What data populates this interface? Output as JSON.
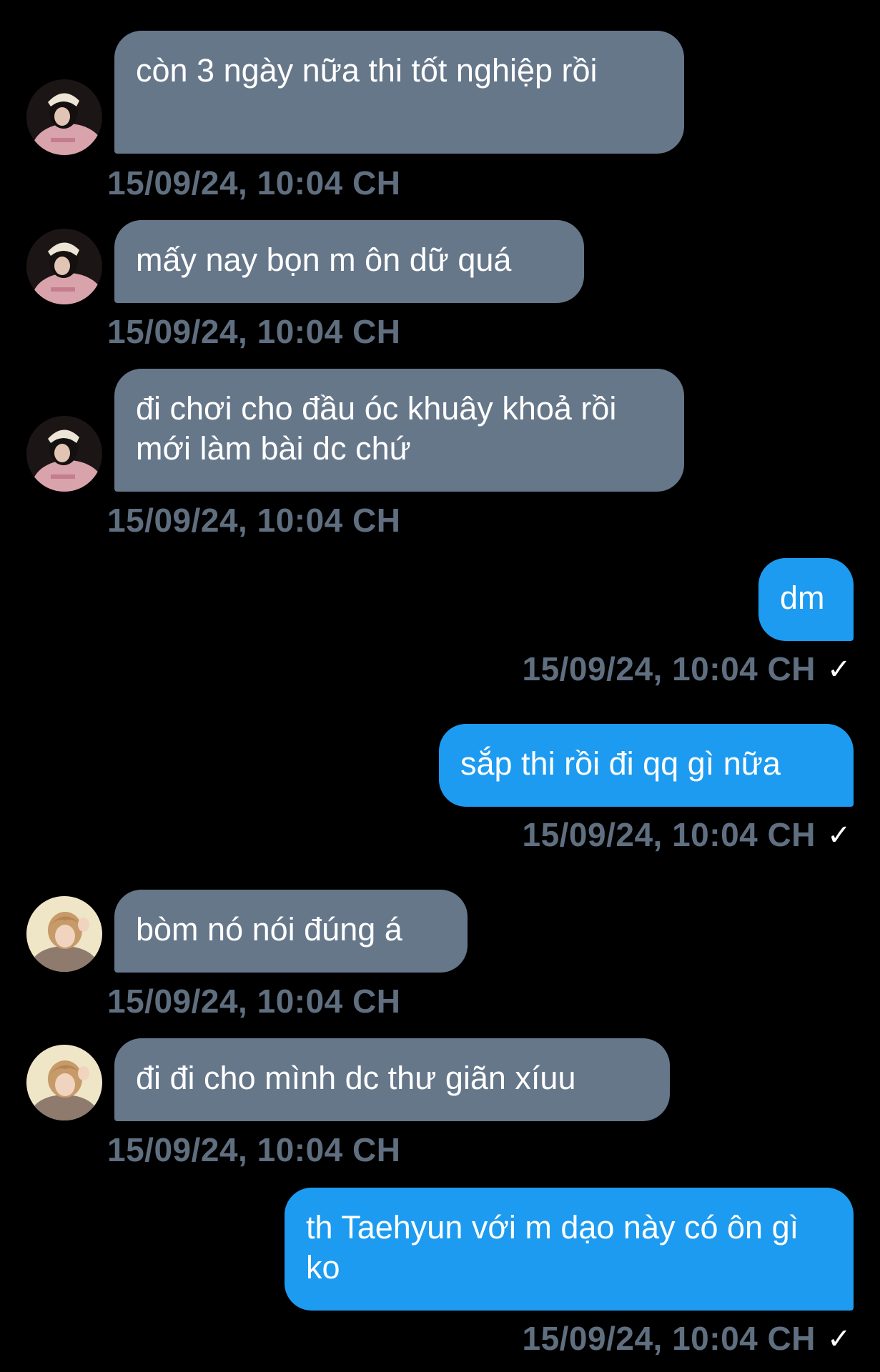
{
  "colors": {
    "background": "#000000",
    "incoming_bubble": "#66778a",
    "outgoing_bubble": "#1d9bf0",
    "timestamp": "#5f6f80",
    "text": "#ffffff"
  },
  "messages": [
    {
      "direction": "incoming",
      "avatar": "avatar-girl-pink-hoodie",
      "text": "còn 3 ngày nữa thi tốt nghiệp rồi",
      "time": "15/09/24, 10:04 CH"
    },
    {
      "direction": "incoming",
      "avatar": "avatar-girl-pink-hoodie",
      "text": "mấy nay bọn m ôn dữ quá",
      "time": "15/09/24, 10:04 CH"
    },
    {
      "direction": "incoming",
      "avatar": "avatar-girl-pink-hoodie",
      "text": "đi chơi cho đầu óc khuây khoả rồi mới làm bài dc chứ",
      "time": "15/09/24, 10:04 CH"
    },
    {
      "direction": "outgoing",
      "text": "dm",
      "time": "15/09/24, 10:04 CH",
      "status_icon": "check-icon",
      "status_glyph": "✓"
    },
    {
      "direction": "outgoing",
      "text": "sắp thi rồi đi qq gì nữa",
      "time": "15/09/24, 10:04 CH",
      "status_icon": "check-icon",
      "status_glyph": "✓"
    },
    {
      "direction": "incoming",
      "avatar": "avatar-boy-light-hair",
      "text": "bòm nó nói đúng á",
      "time": "15/09/24, 10:04 CH"
    },
    {
      "direction": "incoming",
      "avatar": "avatar-boy-light-hair",
      "text": "đi đi cho mình dc thư giãn xíuu",
      "time": "15/09/24, 10:04 CH"
    },
    {
      "direction": "outgoing",
      "text": "th Taehyun với m dạo này có ôn gì ko",
      "time": "15/09/24, 10:04 CH",
      "status_icon": "check-icon",
      "status_glyph": "✓"
    }
  ]
}
